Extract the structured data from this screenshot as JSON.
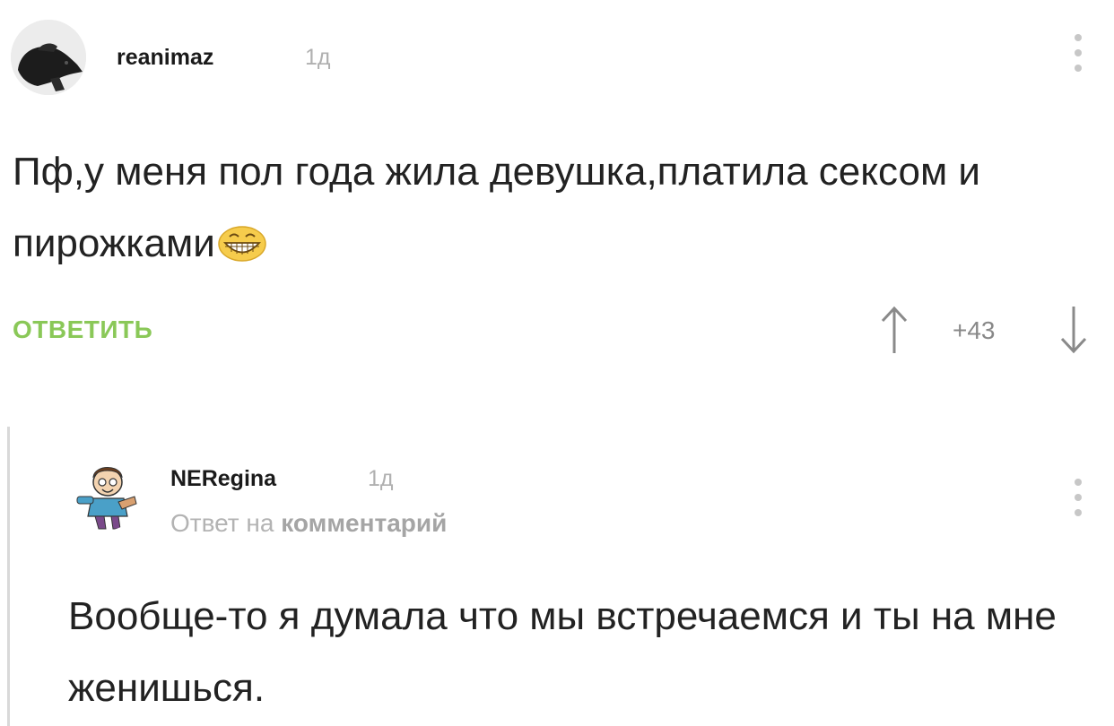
{
  "comments": [
    {
      "username": "reanimaz",
      "time": "1д",
      "text": "Пф,у меня пол года жила девушка,платила сексом и пирожками",
      "reply_label": "ОТВЕТИТЬ",
      "score": "+43"
    },
    {
      "username": "NERegina",
      "time": "1д",
      "reply_prefix": "Ответ на",
      "reply_target": "комментарий",
      "text": "Вообще-то я думала что мы встречаемся и ты на мне женишься."
    }
  ],
  "colors": {
    "reply_green": "#8ac858",
    "muted_gray": "#b0b0b0",
    "text": "#222222"
  },
  "icons": {
    "emoji": "grinning-face-icon",
    "menu": "more-vertical-icon",
    "upvote": "arrow-up-icon",
    "downvote": "arrow-down-icon"
  }
}
